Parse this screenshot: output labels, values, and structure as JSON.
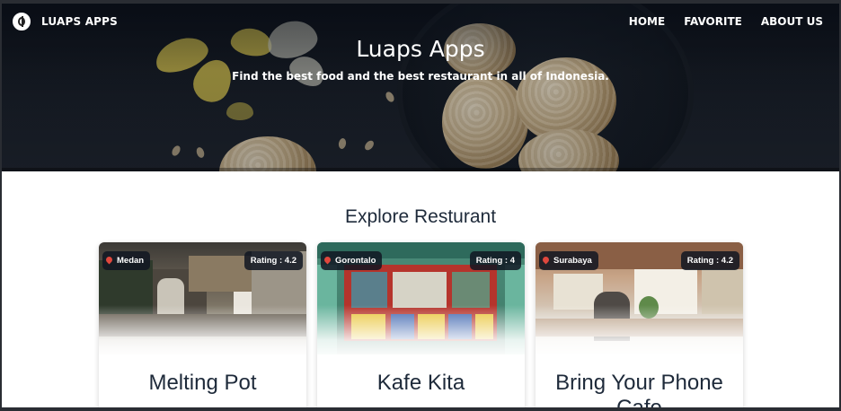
{
  "nav": {
    "brand": "LUAPS APPS",
    "links": [
      "HOME",
      "FAVORITE",
      "ABOUT US"
    ]
  },
  "hero": {
    "title": "Luaps Apps",
    "subtitle": "Find the best food and the best restaurant in all of Indonesia."
  },
  "section": {
    "title": "Explore Resturant"
  },
  "restaurants": [
    {
      "city": "Medan",
      "rating": "Rating : 4.2",
      "name": "Melting Pot"
    },
    {
      "city": "Gorontalo",
      "rating": "Rating : 4",
      "name": "Kafe Kita"
    },
    {
      "city": "Surabaya",
      "rating": "Rating : 4.2",
      "name": "Bring Your Phone Cafe"
    }
  ],
  "colors": {
    "badge_bg": "#101622",
    "pin": "#e0473d",
    "heading": "#1e2a3a"
  },
  "icons": {
    "logo": "fork-knife-logo-icon",
    "pin": "map-pin-icon"
  }
}
